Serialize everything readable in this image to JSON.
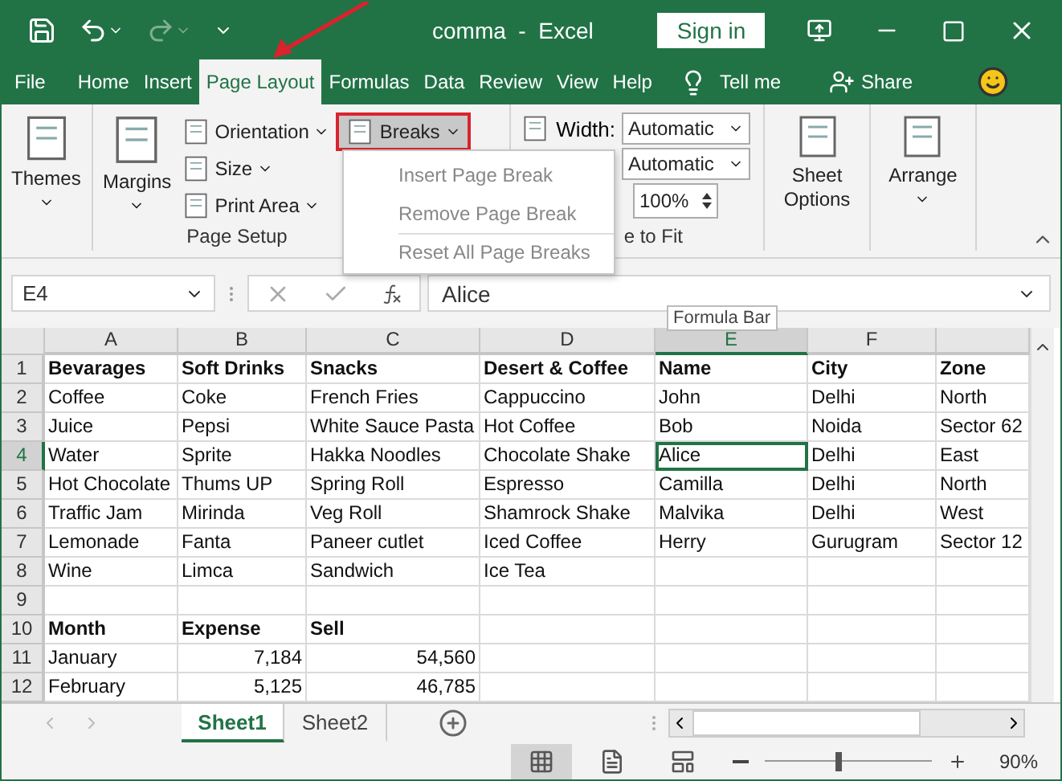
{
  "title_bar": {
    "title": "comma  -  Excel",
    "sign_in": "Sign in"
  },
  "tabs": [
    {
      "label": "File",
      "selected": false
    },
    {
      "label": "Home",
      "selected": false
    },
    {
      "label": "Insert",
      "selected": false
    },
    {
      "label": "Page Layout",
      "selected": true
    },
    {
      "label": "Formulas",
      "selected": false
    },
    {
      "label": "Data",
      "selected": false
    },
    {
      "label": "Review",
      "selected": false
    },
    {
      "label": "View",
      "selected": false
    },
    {
      "label": "Help",
      "selected": false
    }
  ],
  "tell_me": "Tell me",
  "share": "Share",
  "ribbon": {
    "themes": "Themes",
    "page_setup": {
      "margins": "Margins",
      "orientation": "Orientation",
      "size": "Size",
      "print_area": "Print Area",
      "breaks": {
        "label": "Breaks",
        "highlighted": true
      },
      "label": "Page Setup"
    },
    "scale_to_fit": {
      "width_label": "Width:",
      "width": "Automatic",
      "height": "Automatic",
      "scale": "100%",
      "label": "e to Fit"
    },
    "sheet_options": "Sheet Options",
    "arrange": "Arrange"
  },
  "breaks_menu": [
    {
      "label": "Insert Page Break",
      "disabled": true
    },
    {
      "label": "Remove Page Break",
      "disabled": true
    },
    {
      "label": "Reset All Page Breaks",
      "disabled": true
    }
  ],
  "formula_bar": {
    "name_box": "E4",
    "value": "Alice",
    "tooltip": "Formula Bar"
  },
  "columns": [
    {
      "label": "A",
      "selected": false
    },
    {
      "label": "B",
      "selected": false
    },
    {
      "label": "C",
      "selected": false
    },
    {
      "label": "D",
      "selected": false
    },
    {
      "label": "E",
      "selected": true
    },
    {
      "label": "F",
      "selected": false
    }
  ],
  "rows": [
    {
      "number": "1",
      "selected": false,
      "bold": true,
      "cells": [
        "Bevarages",
        "Soft Drinks",
        "Snacks",
        "Desert & Coffee",
        "Name",
        "City",
        "Zone"
      ]
    },
    {
      "number": "2",
      "selected": false,
      "bold": false,
      "cells": [
        "Coffee",
        "Coke",
        "French Fries",
        "Cappuccino",
        "John",
        "Delhi",
        "North"
      ]
    },
    {
      "number": "3",
      "selected": false,
      "bold": false,
      "cells": [
        "Juice",
        "Pepsi",
        "White Sauce Pasta",
        "Hot Coffee",
        "Bob",
        "Noida",
        "Sector 62"
      ]
    },
    {
      "number": "4",
      "selected": true,
      "bold": false,
      "cells": [
        "Water",
        "Sprite",
        "Hakka Noodles",
        "Chocolate Shake",
        {
          "text": "Alice",
          "selected": true
        },
        "Delhi",
        "East"
      ]
    },
    {
      "number": "5",
      "selected": false,
      "bold": false,
      "cells": [
        "Hot Chocolate",
        "Thums UP",
        "Spring Roll",
        "Espresso",
        "Camilla",
        "Delhi",
        "North"
      ]
    },
    {
      "number": "6",
      "selected": false,
      "bold": false,
      "cells": [
        "Traffic Jam",
        "Mirinda",
        "Veg Roll",
        "Shamrock Shake",
        "Malvika",
        "Delhi",
        "West"
      ]
    },
    {
      "number": "7",
      "selected": false,
      "bold": false,
      "cells": [
        "Lemonade",
        "Fanta",
        "Paneer cutlet",
        "Iced Coffee",
        "Herry",
        "Gurugram",
        "Sector 12"
      ]
    },
    {
      "number": "8",
      "selected": false,
      "bold": false,
      "cells": [
        "Wine",
        "Limca",
        "Sandwich",
        "Ice Tea"
      ]
    },
    {
      "number": "9",
      "selected": false,
      "cells": []
    },
    {
      "number": "10",
      "selected": false,
      "bold": true,
      "cells": [
        "Month",
        "Expense",
        "Sell"
      ]
    },
    {
      "number": "11",
      "selected": false,
      "bold": false,
      "cells": [
        "January",
        {
          "text": "7,184",
          "kind": "number"
        },
        {
          "text": "54,560",
          "kind": "number"
        }
      ]
    },
    {
      "number": "12",
      "selected": false,
      "bold": false,
      "cells": [
        "February",
        {
          "text": "5,125",
          "kind": "number"
        },
        {
          "text": "46,785",
          "kind": "number"
        }
      ]
    }
  ],
  "sheets": [
    {
      "label": "Sheet1",
      "selected": true
    },
    {
      "label": "Sheet2",
      "selected": false
    }
  ],
  "status_bar": {
    "views": [
      {
        "kind": "normal",
        "selected": true
      },
      {
        "kind": "page_layout",
        "selected": false
      },
      {
        "kind": "page_break",
        "selected": false
      }
    ],
    "zoom": {
      "level": 0.46,
      "label": "90%"
    }
  }
}
